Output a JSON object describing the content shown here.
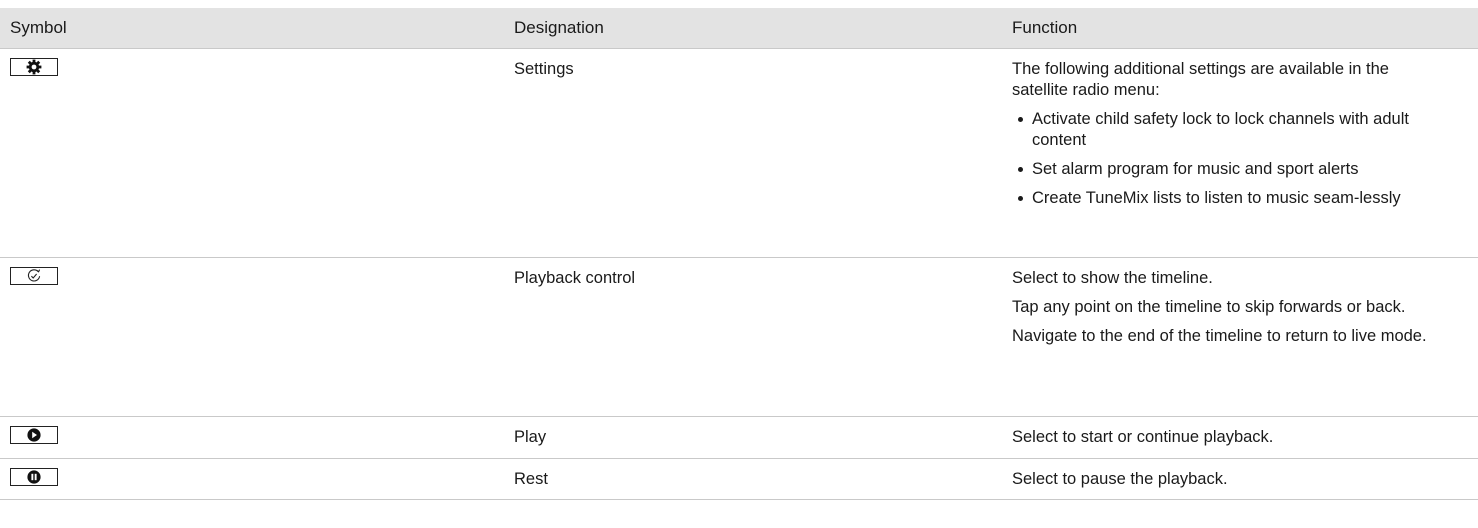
{
  "header": {
    "symbol": "Symbol",
    "designation": "Designation",
    "function": "Function"
  },
  "rows": [
    {
      "icon": "gear-icon",
      "designation": "Settings",
      "function_text": "The following additional settings are available in the satellite radio menu:",
      "bullets": [
        "Activate child safety lock to lock channels with adult content",
        "Set alarm program for music and sport alerts",
        "Create TuneMix lists to listen to music seam-lessly"
      ]
    },
    {
      "icon": "playback-clock-icon",
      "designation": "Playback control",
      "paragraphs": [
        "Select to show the timeline.",
        "Tap any point on the timeline to skip forwards or back.",
        "Navigate to the end of the timeline to return to live mode."
      ]
    },
    {
      "icon": "play-icon",
      "designation": "Play",
      "function_text": "Select to start or continue playback."
    },
    {
      "icon": "pause-icon",
      "designation": "Rest",
      "function_text": "Select to pause the playback."
    }
  ]
}
